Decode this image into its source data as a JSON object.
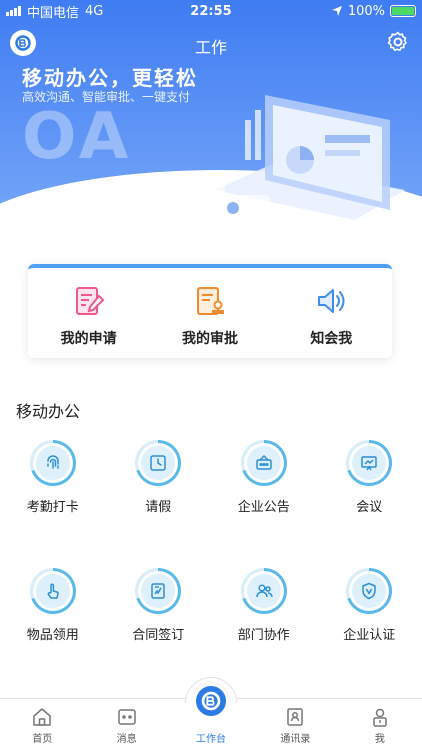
{
  "status_bar": {
    "carrier": "中国电信",
    "network": "4G",
    "time": "22:55",
    "battery": "100%"
  },
  "header": {
    "title": "工作"
  },
  "banner": {
    "title": "移动办公，更轻松",
    "subtitle": "高效沟通、智能审批、一键支付",
    "logo_text": "OA"
  },
  "quick_actions": [
    {
      "label": "我的申请",
      "icon": "edit-document-icon",
      "color": "#ee5a8a"
    },
    {
      "label": "我的审批",
      "icon": "approval-stamp-icon",
      "color": "#f08a2c"
    },
    {
      "label": "知会我",
      "icon": "speaker-icon",
      "color": "#3d8df0"
    }
  ],
  "section": {
    "title": "移动办公"
  },
  "apps": [
    {
      "label": "考勤打卡",
      "icon": "fingerprint-icon"
    },
    {
      "label": "请假",
      "icon": "clock-icon"
    },
    {
      "label": "企业公告",
      "icon": "notice-board-icon"
    },
    {
      "label": "会议",
      "icon": "presentation-icon"
    },
    {
      "label": "物品领用",
      "icon": "hand-pointer-icon"
    },
    {
      "label": "合同签订",
      "icon": "contract-icon"
    },
    {
      "label": "部门协作",
      "icon": "team-icon"
    },
    {
      "label": "企业认证",
      "icon": "shield-check-icon"
    }
  ],
  "tabs": [
    {
      "label": "首页",
      "icon": "home-icon"
    },
    {
      "label": "消息",
      "icon": "message-icon"
    },
    {
      "label": "工作台",
      "icon": "workbench-icon",
      "active": true
    },
    {
      "label": "通讯录",
      "icon": "contacts-icon"
    },
    {
      "label": "我",
      "icon": "user-icon"
    }
  ],
  "colors": {
    "brand": "#2c7be5",
    "banner": "#4a86f3",
    "ring": "#58b9ea"
  }
}
